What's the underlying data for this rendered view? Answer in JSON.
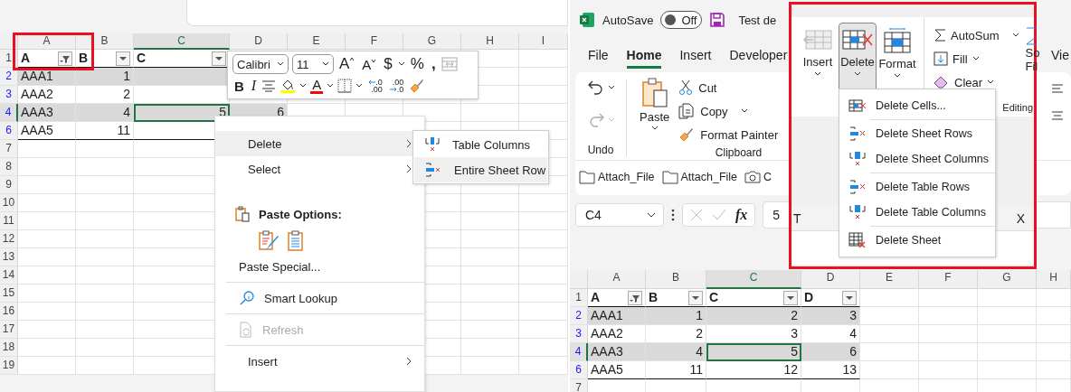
{
  "left_window": {
    "columns": [
      {
        "label": "A",
        "selected": false
      },
      {
        "label": "B",
        "selected": false
      },
      {
        "label": "C",
        "selected": true
      },
      {
        "label": "D",
        "selected": false
      },
      {
        "label": "E",
        "selected": false
      },
      {
        "label": "F",
        "selected": false
      },
      {
        "label": "G",
        "selected": false
      },
      {
        "label": "H",
        "selected": false
      },
      {
        "label": "I",
        "selected": false
      }
    ],
    "header_row": {
      "number": "1",
      "cells": [
        {
          "text": "A",
          "filtered": true
        },
        {
          "text": "B",
          "filtered": false
        },
        {
          "text": "C",
          "filtered": false
        }
      ]
    },
    "rows": [
      {
        "number": "2",
        "selected": false,
        "banded": true,
        "cells": [
          {
            "text": "AAA1",
            "selected": false
          },
          {
            "text": "1",
            "selected": false
          }
        ]
      },
      {
        "number": "3",
        "selected": false,
        "banded": false,
        "cells": [
          {
            "text": "AAA2",
            "selected": false
          },
          {
            "text": "2",
            "selected": false
          }
        ]
      },
      {
        "number": "4",
        "selected": true,
        "banded": true,
        "cells": [
          {
            "text": "AAA3",
            "selected": false
          },
          {
            "text": "4",
            "selected": false
          },
          {
            "text": "5",
            "selected": true
          },
          {
            "text": "6",
            "selected": false
          }
        ]
      },
      {
        "number": "6",
        "selected": false,
        "banded": false,
        "cells": [
          {
            "text": "AAA5",
            "selected": false
          },
          {
            "text": "11",
            "selected": false
          }
        ]
      }
    ],
    "empty_rows": [
      "7",
      "8",
      "9",
      "10",
      "11",
      "12",
      "13",
      "14",
      "15",
      "16",
      "17",
      "18",
      "19"
    ],
    "mini_toolbar": {
      "font": "Calibri",
      "size": "11",
      "grow_font": "A",
      "shrink_font": "A",
      "currency": "$",
      "percent": "%",
      "comma": ",",
      "bold": "B",
      "italic": "I",
      "font_color": "A",
      "decrease_decimal": [
        ".0",
        ".00"
      ],
      "increase_decimal": [
        ".00",
        ".0"
      ]
    },
    "context_menu": [
      {
        "kind": "submenu",
        "label": "Delete",
        "selected": true,
        "disabled": false,
        "divider_before": false
      },
      {
        "kind": "submenu",
        "label": "Select",
        "selected": false,
        "disabled": false,
        "divider_before": false
      },
      {
        "kind": "heading",
        "label": "Paste Options:",
        "selected": false,
        "disabled": false,
        "divider_before": false
      },
      {
        "kind": "plain",
        "label": "Paste Special...",
        "selected": false,
        "disabled": false,
        "divider_before": false
      },
      {
        "kind": "lookup",
        "label": "Smart Lookup",
        "selected": false,
        "disabled": false,
        "divider_before": true
      },
      {
        "kind": "refresh",
        "label": "Refresh",
        "selected": false,
        "disabled": true,
        "divider_before": true
      },
      {
        "kind": "submenu",
        "label": "Insert",
        "selected": false,
        "disabled": false,
        "divider_before": true
      }
    ],
    "submenu": [
      {
        "kind": "columns",
        "label": "Table Columns",
        "selected": false
      },
      {
        "kind": "rows",
        "label": "Entire Sheet Row",
        "selected": true
      }
    ]
  },
  "right_window": {
    "title_bar": {
      "autosave_label": "AutoSave",
      "autosave": {
        "on": false,
        "label": "Off"
      },
      "file_name": "Test de"
    },
    "ribbon_tabs": [
      {
        "label": "File",
        "selected": false
      },
      {
        "label": "Home",
        "selected": true
      },
      {
        "label": "Insert",
        "selected": false
      },
      {
        "label": "Developer",
        "selected": false
      },
      {
        "label": "Vie",
        "selected": false
      }
    ],
    "undo_group": {
      "label": "Undo"
    },
    "clipboard_group": {
      "label": "Clipboard",
      "paste": "Paste",
      "cut": "Cut",
      "copy": "Copy",
      "format_painter": "Format Painter"
    },
    "quick_bar": [
      {
        "kind": "folder",
        "label": "Attach_File"
      },
      {
        "kind": "folder",
        "label": "Attach_File"
      },
      {
        "kind": "camera",
        "label": "C"
      }
    ],
    "formula_bar": {
      "name_box": "C4",
      "function_label": "fx",
      "value": "5"
    },
    "columns": [
      {
        "label": "A",
        "selected": false
      },
      {
        "label": "B",
        "selected": false
      },
      {
        "label": "C",
        "selected": true
      },
      {
        "label": "D",
        "selected": false
      },
      {
        "label": "E",
        "selected": false
      },
      {
        "label": "F",
        "selected": false
      },
      {
        "label": "G",
        "selected": false
      },
      {
        "label": "H",
        "selected": false
      }
    ],
    "header_row": {
      "number": "1",
      "cells": [
        {
          "text": "A",
          "filtered": true
        },
        {
          "text": "B",
          "filtered": false
        },
        {
          "text": "C",
          "filtered": false
        },
        {
          "text": "D",
          "filtered": false
        }
      ]
    },
    "rows": [
      {
        "number": "2",
        "selected": false,
        "banded": true,
        "cells": [
          {
            "text": "AAA1",
            "selected": false
          },
          {
            "text": "1",
            "selected": false
          },
          {
            "text": "2",
            "selected": false
          },
          {
            "text": "3",
            "selected": false
          }
        ]
      },
      {
        "number": "3",
        "selected": false,
        "banded": false,
        "cells": [
          {
            "text": "AAA2",
            "selected": false
          },
          {
            "text": "2",
            "selected": false
          },
          {
            "text": "3",
            "selected": false
          },
          {
            "text": "4",
            "selected": false
          }
        ]
      },
      {
        "number": "4",
        "selected": true,
        "banded": true,
        "cells": [
          {
            "text": "AAA3",
            "selected": false
          },
          {
            "text": "4",
            "selected": false
          },
          {
            "text": "5",
            "selected": true
          },
          {
            "text": "6",
            "selected": false
          }
        ]
      },
      {
        "number": "6",
        "selected": false,
        "banded": false,
        "cells": [
          {
            "text": "AAA5",
            "selected": false
          },
          {
            "text": "11",
            "selected": false
          },
          {
            "text": "12",
            "selected": false
          },
          {
            "text": "13",
            "selected": false
          }
        ]
      }
    ],
    "empty_rows": [
      "7"
    ],
    "callout": {
      "cells_group": [
        {
          "kind": "insert",
          "label": "Insert",
          "pressed": false
        },
        {
          "kind": "delete",
          "label": "Delete",
          "pressed": true
        },
        {
          "kind": "format",
          "label": "Format",
          "pressed": false
        }
      ],
      "editing_group": {
        "autosum": "AutoSum",
        "fill": "Fill",
        "clear": "Clear",
        "sort_lines": [
          "So",
          "Fil"
        ],
        "label": "Editing"
      },
      "panel_texts": [
        "T",
        "X"
      ],
      "delete_menu": [
        {
          "kind": "cells",
          "label": "Delete Cells...",
          "divider_before": false
        },
        {
          "kind": "rows",
          "label": "Delete Sheet Rows",
          "divider_before": true
        },
        {
          "kind": "columns",
          "label": "Delete Sheet Columns",
          "divider_before": false
        },
        {
          "kind": "rows",
          "label": "Delete Table Rows",
          "divider_before": true
        },
        {
          "kind": "columns",
          "label": "Delete Table Columns",
          "divider_before": false
        },
        {
          "kind": "sheet",
          "label": "Delete Sheet",
          "divider_before": true
        }
      ]
    }
  }
}
